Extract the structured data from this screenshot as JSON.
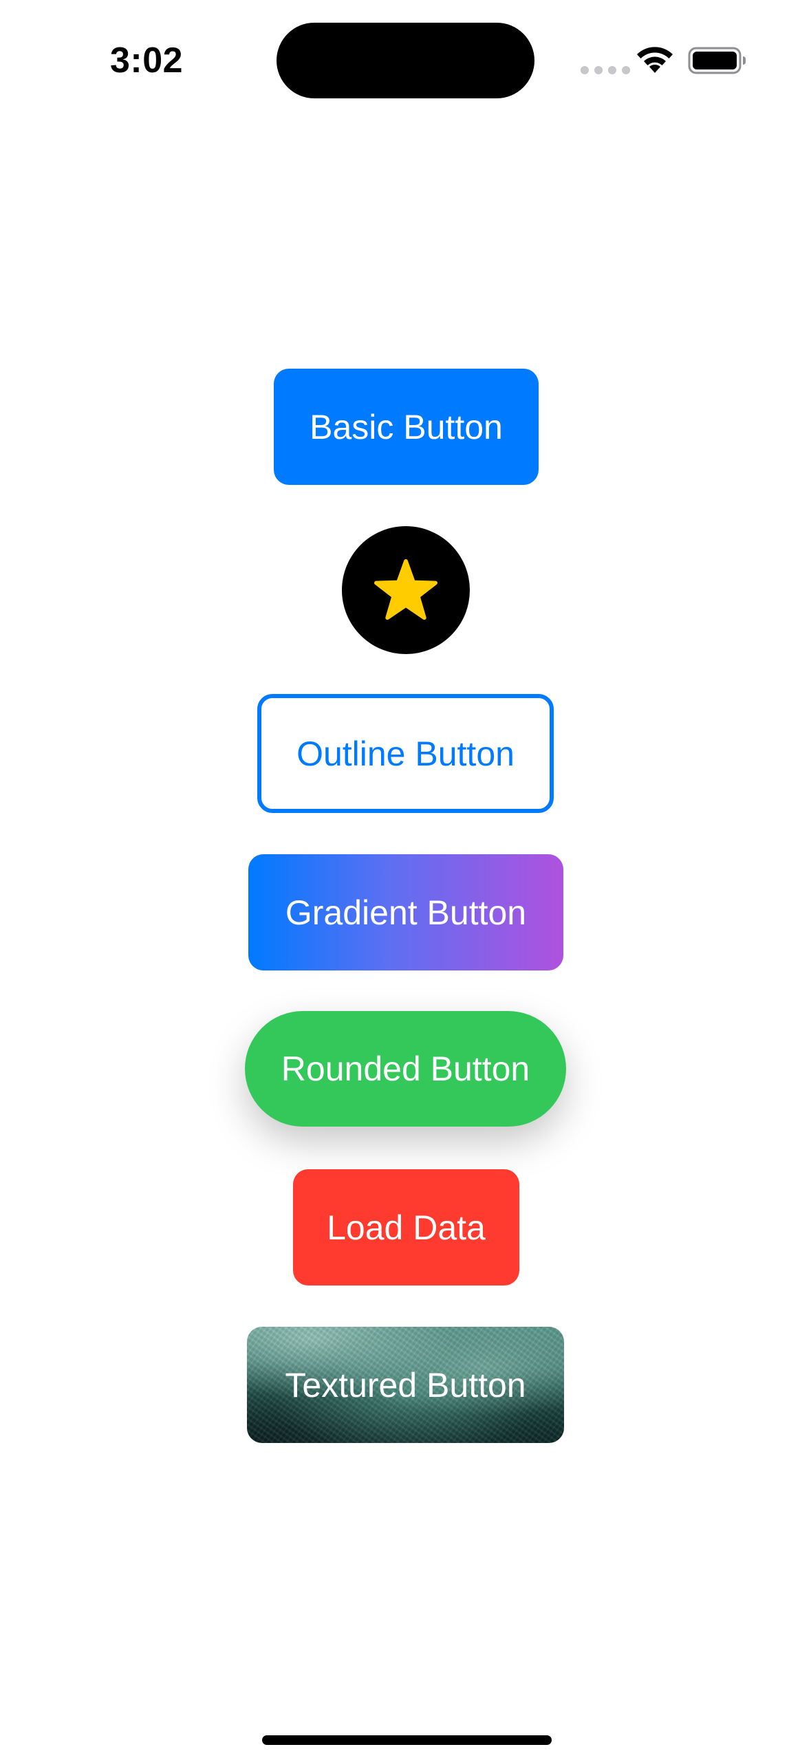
{
  "status_bar": {
    "time": "3:02",
    "icons": [
      "cellular-signal-icon",
      "wifi-icon",
      "battery-icon"
    ]
  },
  "buttons": {
    "basic": {
      "label": "Basic Button",
      "color": "#007aff"
    },
    "star": {
      "icon": "star-icon",
      "background": "#000000",
      "icon_color": "#ffcc00"
    },
    "outline": {
      "label": "Outline Button",
      "color": "#007aff"
    },
    "gradient": {
      "label": "Gradient Button",
      "gradient_colors": [
        "#007aff",
        "#af52de"
      ]
    },
    "rounded": {
      "label": "Rounded Button",
      "color": "#34c759"
    },
    "load": {
      "label": "Load Data",
      "color": "#ff3b30"
    },
    "textured": {
      "label": "Textured Button",
      "texture": "dark-teal-stone"
    }
  }
}
